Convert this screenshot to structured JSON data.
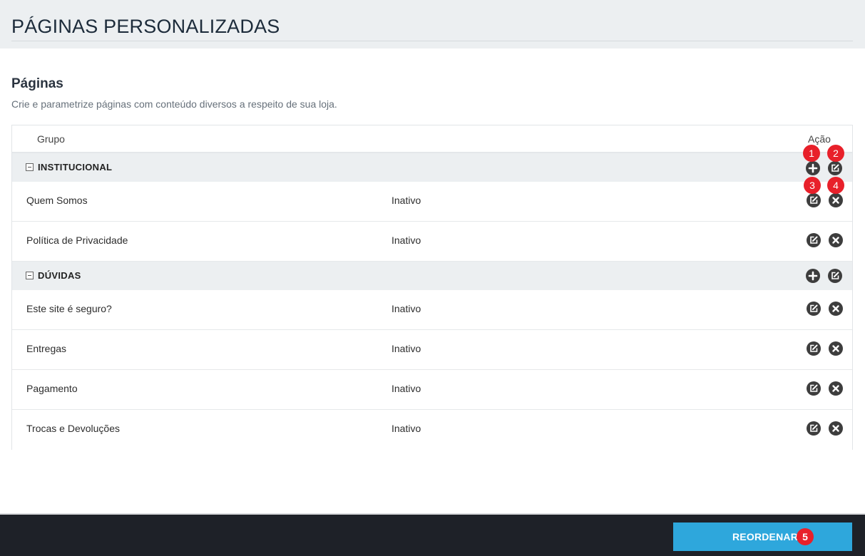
{
  "header": {
    "title": "PÁGINAS PERSONALIZADAS"
  },
  "section": {
    "title": "Páginas",
    "description": "Crie e parametrize páginas com conteúdo diversos a respeito de sua loja."
  },
  "table": {
    "columns": {
      "group": "Grupo",
      "action": "Ação"
    },
    "groups": [
      {
        "label": "INSTITUCIONAL",
        "actions": [
          "plus-icon",
          "edit-icon"
        ],
        "items": [
          {
            "name": "Quem Somos",
            "status": "Inativo"
          },
          {
            "name": "Política de Privacidade",
            "status": "Inativo"
          }
        ]
      },
      {
        "label": "DÚVIDAS",
        "actions": [
          "plus-icon",
          "edit-icon"
        ],
        "items": [
          {
            "name": "Este site é seguro?",
            "status": "Inativo"
          },
          {
            "name": "Entregas",
            "status": "Inativo"
          },
          {
            "name": "Pagamento",
            "status": "Inativo"
          },
          {
            "name": "Trocas e Devoluções",
            "status": "Inativo"
          }
        ]
      }
    ],
    "item_actions": [
      "edit-icon",
      "close-icon"
    ]
  },
  "annotations": [
    "1",
    "2",
    "3",
    "4",
    "5"
  ],
  "footer": {
    "reorder_label": "REORDENAR"
  },
  "colors": {
    "header_bg": "#eceff1",
    "group_row_bg": "#eceff1",
    "icon": "#3d3d3d",
    "badge": "#e8202a",
    "footer_bg": "#1e2128",
    "button": "#2ea7dc"
  }
}
